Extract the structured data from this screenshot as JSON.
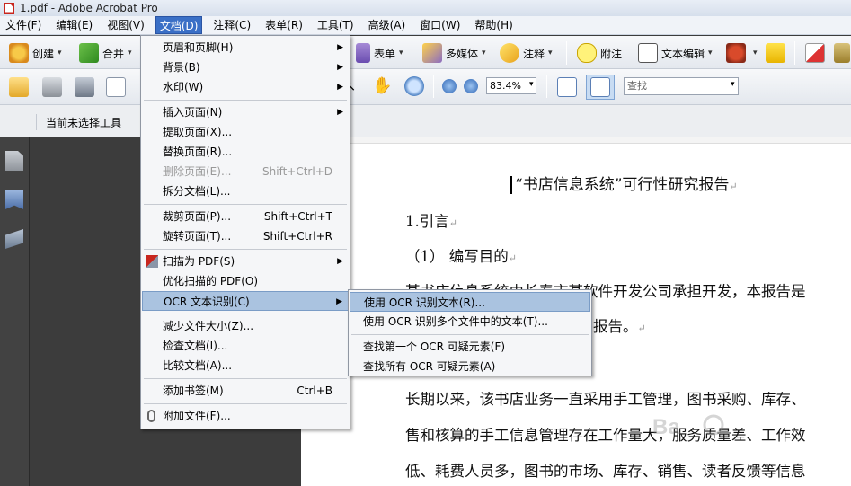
{
  "titlebar": {
    "title": "1.pdf - Adobe Acrobat Pro"
  },
  "menubar": {
    "items": [
      "文件(F)",
      "编辑(E)",
      "视图(V)",
      "文档(D)",
      "注释(C)",
      "表单(R)",
      "工具(T)",
      "高级(A)",
      "窗口(W)",
      "帮助(H)"
    ]
  },
  "toolbar1": {
    "create": "创建",
    "combine": "合并",
    "forms": "表单",
    "multimedia": "多媒体",
    "comment": "注释",
    "sticky_note": "附注",
    "text_edit": "文本编辑"
  },
  "toolbar2": {
    "zoom": "83.4%",
    "find_placeholder": "查找"
  },
  "toolbar3": {
    "status": "当前未选择工具"
  },
  "document_menu": {
    "items": [
      {
        "label": "页眉和页脚(H)",
        "shortcut": "",
        "submenu": true
      },
      {
        "label": "背景(B)",
        "shortcut": "",
        "submenu": true
      },
      {
        "label": "水印(W)",
        "shortcut": "",
        "submenu": true
      },
      {
        "label": "插入页面(N)",
        "shortcut": "",
        "submenu": true
      },
      {
        "label": "提取页面(X)...",
        "shortcut": ""
      },
      {
        "label": "替换页面(R)...",
        "shortcut": ""
      },
      {
        "label": "删除页面(E)...",
        "shortcut": "Shift+Ctrl+D"
      },
      {
        "label": "拆分文档(L)...",
        "shortcut": ""
      },
      {
        "label": "裁剪页面(P)...",
        "shortcut": "Shift+Ctrl+T"
      },
      {
        "label": "旋转页面(T)...",
        "shortcut": "Shift+Ctrl+R"
      },
      {
        "label": "扫描为 PDF(S)",
        "shortcut": "",
        "submenu": true
      },
      {
        "label": "优化扫描的 PDF(O)",
        "shortcut": ""
      },
      {
        "label": "OCR 文本识别(C)",
        "shortcut": "",
        "submenu": true
      },
      {
        "label": "减少文件大小(Z)...",
        "shortcut": ""
      },
      {
        "label": "检查文档(I)...",
        "shortcut": ""
      },
      {
        "label": "比较文档(A)...",
        "shortcut": ""
      },
      {
        "label": "添加书签(M)",
        "shortcut": "Ctrl+B"
      },
      {
        "label": "附加文件(F)...",
        "shortcut": ""
      }
    ]
  },
  "ocr_submenu": {
    "items": [
      "使用 OCR 识别文本(R)...",
      "使用 OCR 识别多个文件中的文本(T)...",
      "查找第一个 OCR 可疑元素(F)",
      "查找所有 OCR 可疑元素(A)"
    ]
  },
  "document": {
    "title": "“书店信息系统”可行性研究报告",
    "heading1": "1.引言",
    "heading2": "（1）  编写目的",
    "line1": "某书店信息系统由长春市某软件开发公司承担开发，本报告是",
    "line2": "报告。",
    "line3": "长期以来，该书店业务一直采用手工管理，图书采购、库存、",
    "line4": "售和核算的手工信息管理存在工作量大，服务质量差、工作效",
    "line5": "低、耗费人员多，图书的市场、库存、销售、读者反馈等信息"
  },
  "colors": {
    "menu_highlight": "#aac3e0",
    "menubar_active": "#3a6fc6"
  }
}
